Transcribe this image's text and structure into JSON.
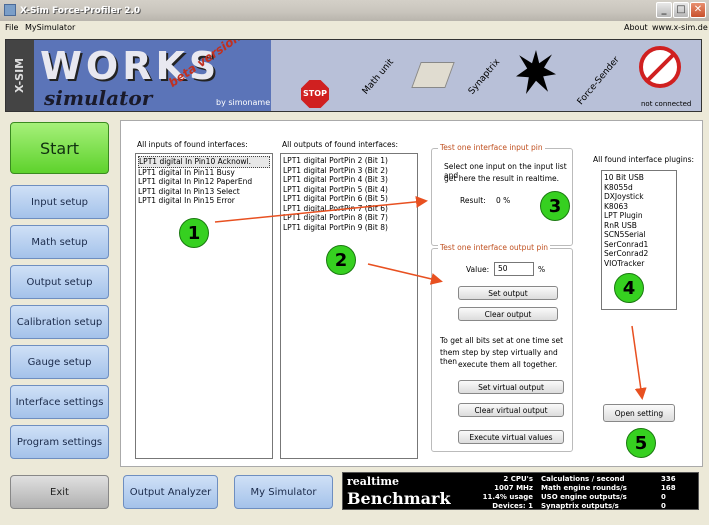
{
  "window": {
    "title": "X-Sim Force-Profiler 2.0"
  },
  "menu": {
    "file": "File",
    "mysimulator": "MySimulator",
    "about": "About",
    "website": "www.x-sim.de"
  },
  "banner": {
    "xsim": "X-SIM",
    "works": "WORKS",
    "simulator": "simulator",
    "beta": "beta version",
    "author": "by simoname",
    "stop": "STOP",
    "math_unit": "Math unit",
    "synaptrix": "Synaptrix",
    "force_sender": "Force-Sender",
    "status": "not connected"
  },
  "nav": {
    "start": "Start",
    "input_setup": "Input setup",
    "math_setup": "Math setup",
    "output_setup": "Output setup",
    "calibration_setup": "Calibration setup",
    "gauge_setup": "Gauge setup",
    "interface_settings": "Interface settings",
    "program_settings": "Program settings",
    "exit": "Exit"
  },
  "bottom": {
    "output_analyzer": "Output Analyzer",
    "my_simulator": "My Simulator"
  },
  "inputs": {
    "label": "All inputs of found interfaces:",
    "items": [
      "LPT1 digital In Pin10 Acknowl.",
      "LPT1 digital In Pin11 Busy",
      "LPT1 digital In Pin12 PaperEnd",
      "LPT1 digital In Pin13 Select",
      "LPT1 digital In Pin15 Error"
    ]
  },
  "outputs": {
    "label": "All outputs of found interfaces:",
    "items": [
      "LPT1 digital PortPin 2 (Bit 1)",
      "LPT1 digital PortPin 3 (Bit 2)",
      "LPT1 digital PortPin 4 (Bit 3)",
      "LPT1 digital PortPin 5 (Bit 4)",
      "LPT1 digital PortPin 6 (Bit 5)",
      "LPT1 digital PortPin 7 (Bit 6)",
      "LPT1 digital PortPin 8 (Bit 7)",
      "LPT1 digital PortPin 9 (Bit 8)"
    ]
  },
  "input_test": {
    "title": "Test one interface input pin",
    "desc1": "Select one input on the input list and",
    "desc2": "get here the result in realtime.",
    "result_label": "Result:",
    "result_value": "0 %"
  },
  "output_test": {
    "title": "Test one interface output pin",
    "value_label": "Value:",
    "value": "50",
    "unit": "%",
    "set_output": "Set output",
    "clear_output": "Clear output",
    "desc1": "To get all bits set at one time set",
    "desc2": "them step by step virtually and then",
    "desc3": "execute them all together.",
    "set_virtual": "Set virtual output",
    "clear_virtual": "Clear virtual output",
    "execute_virtual": "Execute virtual values"
  },
  "plugins": {
    "label": "All found interface plugins:",
    "items": [
      "10 Bit USB",
      "K8055d",
      "DXJoystick",
      "K8063",
      "LPT Plugin",
      "RnR USB",
      "SCN5Serial",
      "SerConrad1",
      "SerConrad2",
      "VIOTracker"
    ],
    "open_setting": "Open setting"
  },
  "markers": {
    "m1": "1",
    "m2": "2",
    "m3": "3",
    "m4": "4",
    "m5": "5"
  },
  "benchmark": {
    "realtime": "realtime",
    "benchmark": "Benchmark",
    "cpus": "2 CPU's",
    "mhz": "1007 MHz",
    "usage": "11.4% usage",
    "devices": "Devices: 1",
    "calc_label": "Calculations / second",
    "calc_value": "336",
    "math_label": "Math engine rounds/s",
    "math_value": "168",
    "uso_label": "USO engine outputs/s",
    "uso_value": "0",
    "syn_label": "Synaptrix outputs/s",
    "syn_value": "0"
  },
  "colors": {
    "accent_green": "#5ed22c",
    "nav_blue": "#a4c2ea",
    "arrow_red": "#e85020",
    "group_title": "#c05020"
  }
}
